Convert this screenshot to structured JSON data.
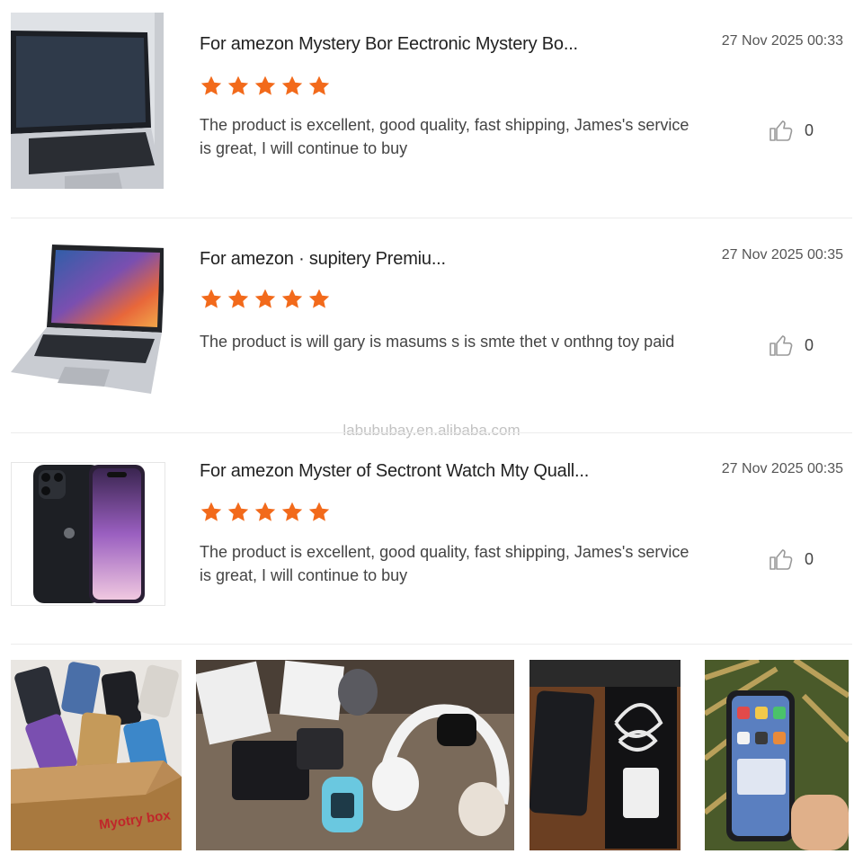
{
  "reviews": [
    {
      "product_title": "For amezon Mystery Bor Eectronic Mystery Bo...",
      "rating": 5,
      "date": "27 Nov 2025 00:33",
      "text": "The product is excellent, good quality, fast shipping, James's service is great, I will continue to buy",
      "likes": "0",
      "thumbnail": "laptop-photo"
    },
    {
      "product_title": "For amezon · supitery Premiu...",
      "rating": 5,
      "date": "27 Nov 2025 00:35",
      "text": "The product is will gary is masums s is smte thet v onthng toy paid",
      "likes": "0",
      "thumbnail": "laptop-photo"
    },
    {
      "product_title": "For amezon Myster of Sectront Watch Mty Quall...",
      "rating": 5,
      "date": "27 Nov 2025 00:35",
      "text": "The product is excellent, good quality, fast shipping, James's service is great, I will continue to buy",
      "likes": "0",
      "thumbnail": "smartphone-photo"
    }
  ],
  "watermark": "labububay.en.alibaba.com",
  "gallery": [
    {
      "name": "mystery-box-photo",
      "label": "Myotry box"
    },
    {
      "name": "electronics-assortment-photo"
    },
    {
      "name": "phone-and-charger-box-photo"
    },
    {
      "name": "phone-in-hand-photo"
    }
  ],
  "colors": {
    "star": "#f26a1b",
    "like_icon": "#9a9a9a",
    "divider": "#ececec"
  },
  "icons": {
    "rating": "star-icon",
    "like": "thumbs-up-icon"
  }
}
